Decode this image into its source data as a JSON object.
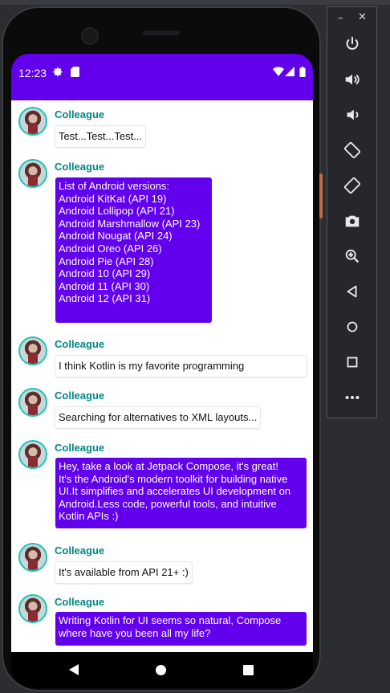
{
  "status_bar": {
    "time": "12:23"
  },
  "messages": [
    {
      "author": "Colleague",
      "text": "Test...Test...Test...",
      "style": "plain"
    },
    {
      "author": "Colleague",
      "text": "List of Android versions:\nAndroid KitKat (API 19)\nAndroid Lollipop (API 21)\nAndroid Marshmallow (API 23)\nAndroid Nougat (API 24)\nAndroid Oreo (API 26)\nAndroid Pie (API 28)\nAndroid 10 (API 29)\nAndroid 11 (API 30)\nAndroid 12 (API 31)",
      "style": "accent"
    },
    {
      "author": "Colleague",
      "text": "I think Kotlin is my favorite programming",
      "style": "plain"
    },
    {
      "author": "Colleague",
      "text": "Searching for alternatives to XML layouts...",
      "style": "plain"
    },
    {
      "author": "Colleague",
      "text": "Hey, take a look at Jetpack Compose, it's great!\nIt's the Android's modern toolkit for building native UI.It simplifies and accelerates UI development on Android.Less code, powerful tools, and intuitive Kotlin APIs :)",
      "style": "accent"
    },
    {
      "author": "Colleague",
      "text": "It's available from API 21+ :)",
      "style": "plain"
    },
    {
      "author": "Colleague",
      "text": "Writing Kotlin for UI seems so natural, Compose where have you been all my life?",
      "style": "accent"
    }
  ],
  "colors": {
    "primary": "#6200ee",
    "author_name": "#018786",
    "avatar_ring": "#1cc5b5"
  },
  "emulator_toolbar": {
    "minimize": "–",
    "close": "✕",
    "buttons": [
      "power-icon",
      "volume-up-icon",
      "volume-down-icon",
      "rotate-left-icon",
      "rotate-right-icon",
      "camera-icon",
      "zoom-icon",
      "back-icon",
      "home-icon",
      "overview-icon",
      "more-icon"
    ]
  }
}
